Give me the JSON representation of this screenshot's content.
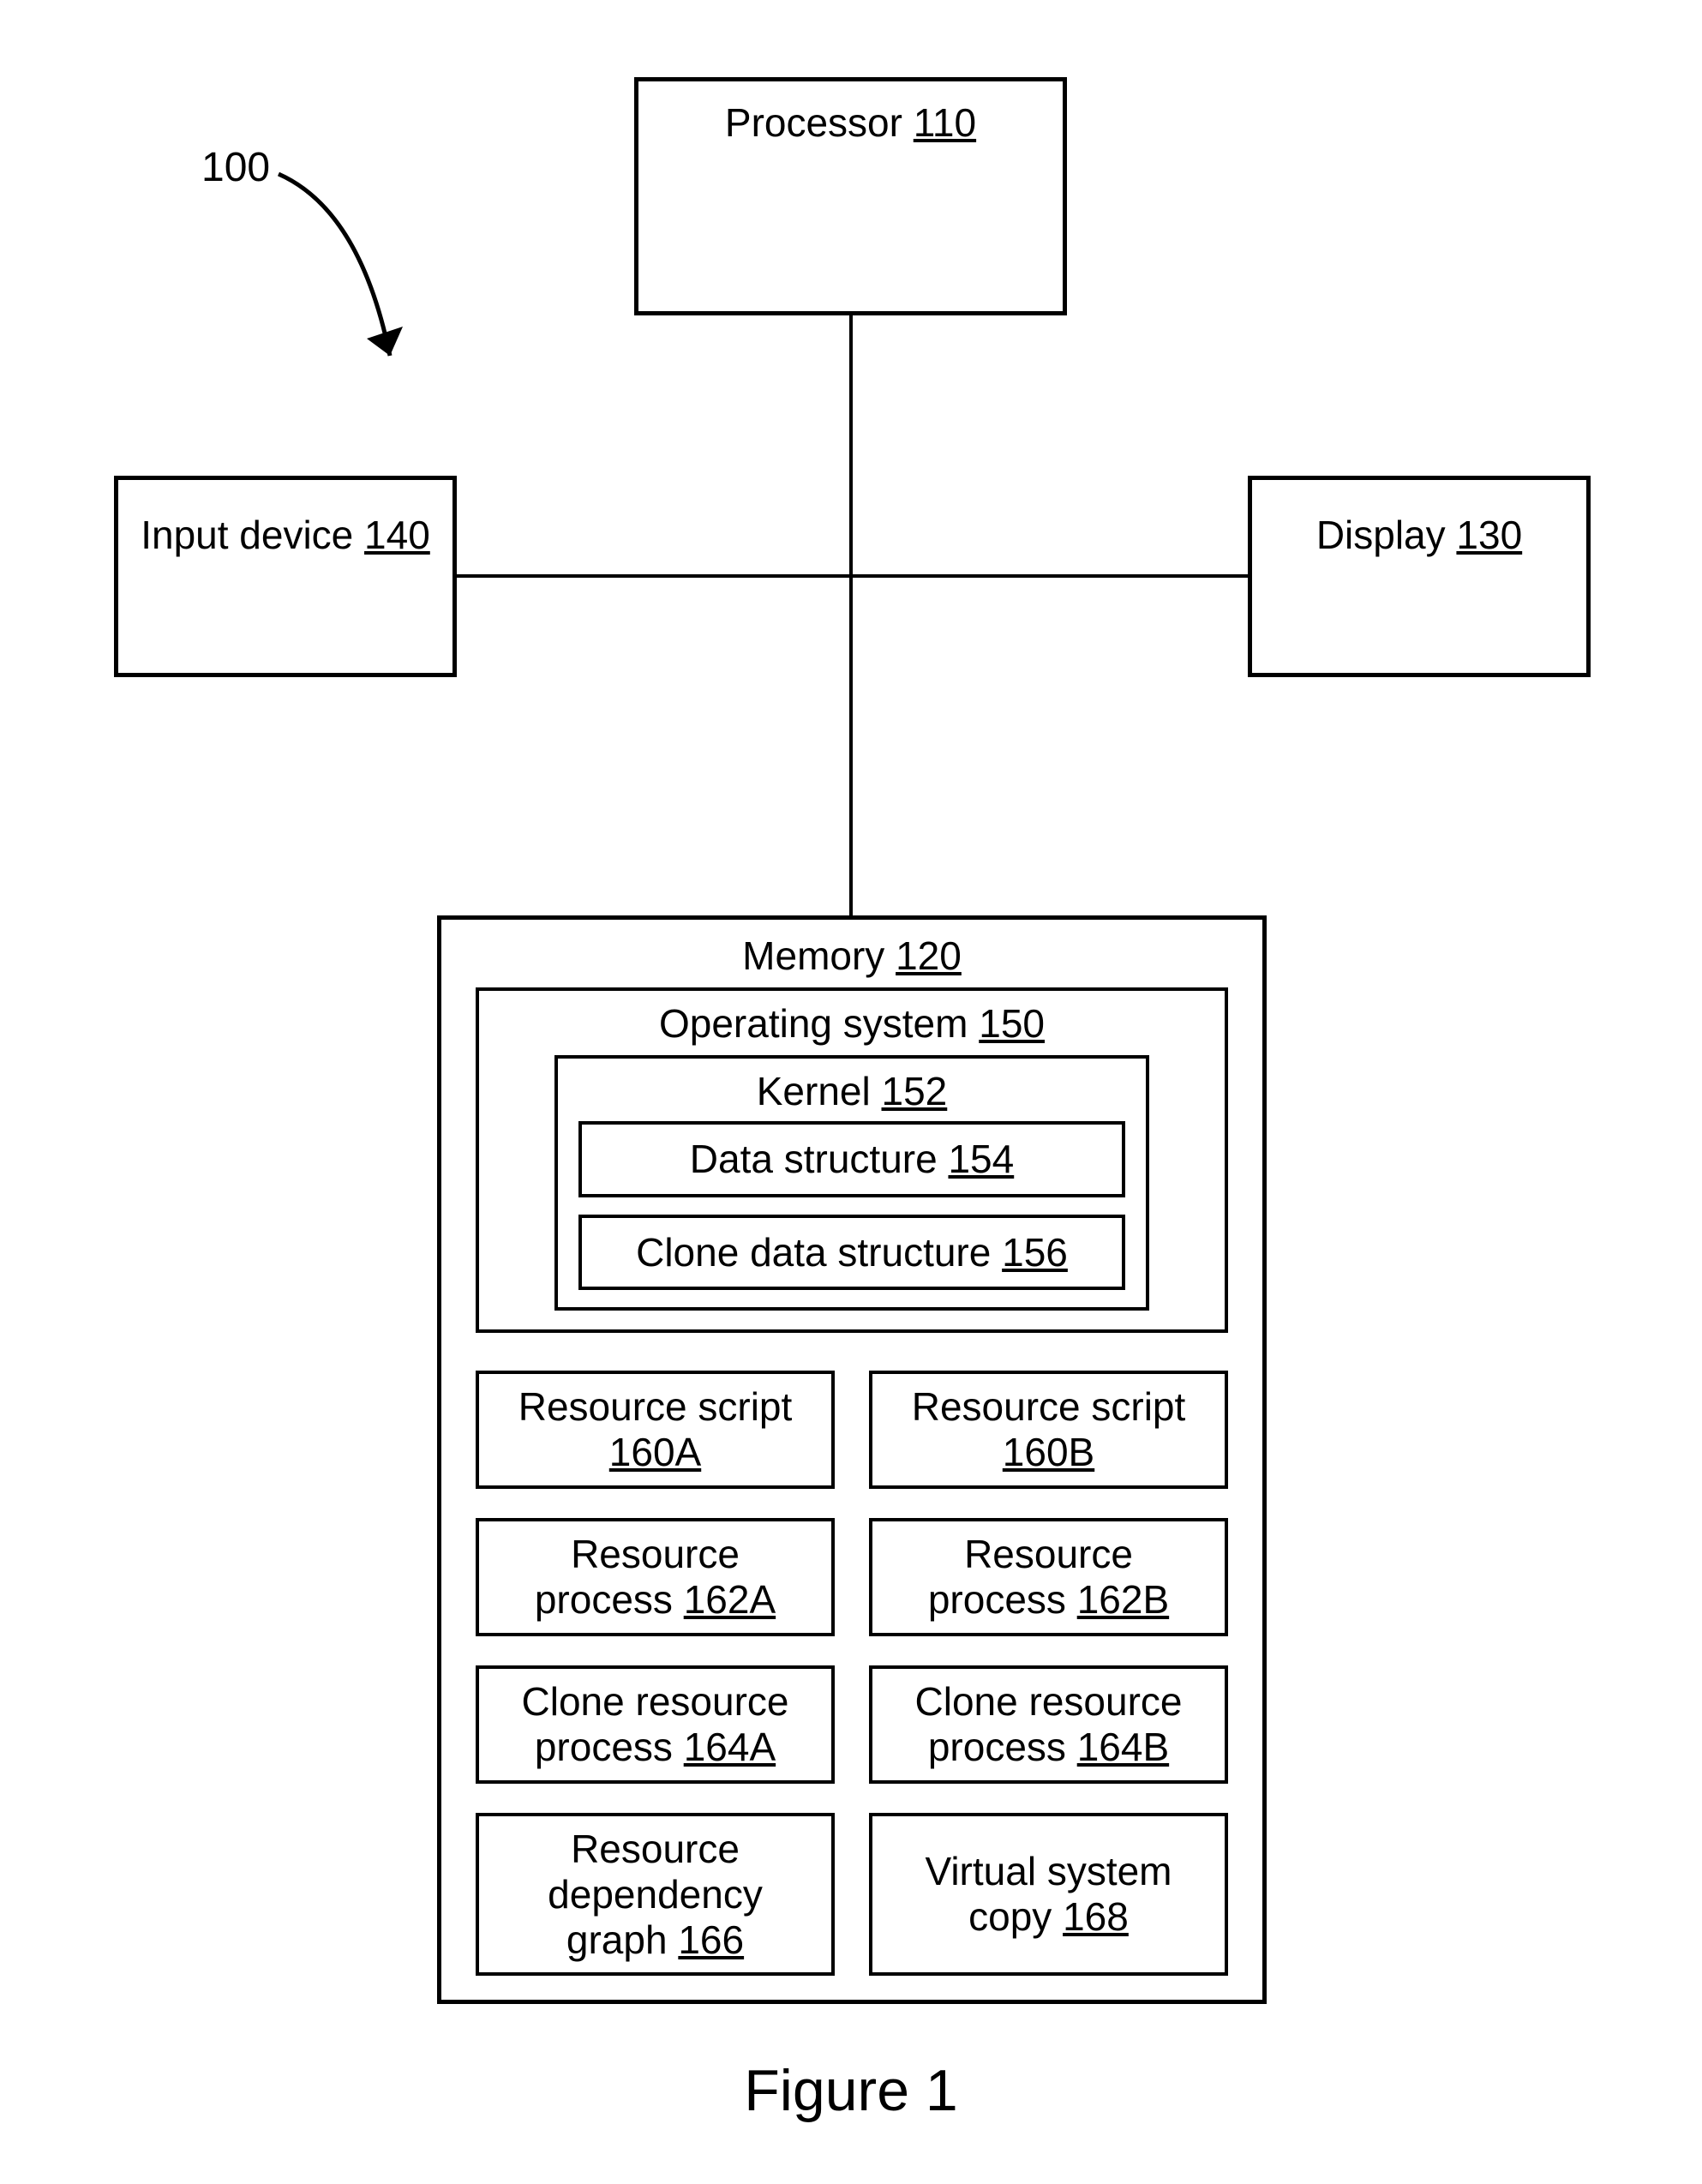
{
  "figure": {
    "caption": "Figure 1",
    "callout": "100"
  },
  "processor": {
    "label": "Processor ",
    "ref": "110"
  },
  "input_device": {
    "label": "Input device ",
    "ref": "140"
  },
  "display": {
    "label": "Display ",
    "ref": "130"
  },
  "memory": {
    "label": "Memory ",
    "ref": "120"
  },
  "os": {
    "label": "Operating system ",
    "ref": "150"
  },
  "kernel": {
    "label": "Kernel ",
    "ref": "152"
  },
  "data_struct": {
    "label": "Data structure ",
    "ref": "154"
  },
  "clone_struct": {
    "label": "Clone data structure ",
    "ref": "156"
  },
  "rs_a": {
    "label": "Resource script",
    "ref": "160A"
  },
  "rs_b": {
    "label": "Resource script",
    "ref": "160B"
  },
  "rp_a": {
    "line1": "Resource",
    "line2": "process ",
    "ref": "162A"
  },
  "rp_b": {
    "line1": "Resource",
    "line2": "process ",
    "ref": "162B"
  },
  "crp_a": {
    "line1": "Clone resource",
    "line2": "process ",
    "ref": "164A"
  },
  "crp_b": {
    "line1": "Clone resource",
    "line2": "process ",
    "ref": "164B"
  },
  "rdg": {
    "line1": "Resource",
    "line2": "dependency",
    "line3": "graph ",
    "ref": "166"
  },
  "vsc": {
    "line1": "Virtual system",
    "line2": "copy ",
    "ref": "168"
  }
}
